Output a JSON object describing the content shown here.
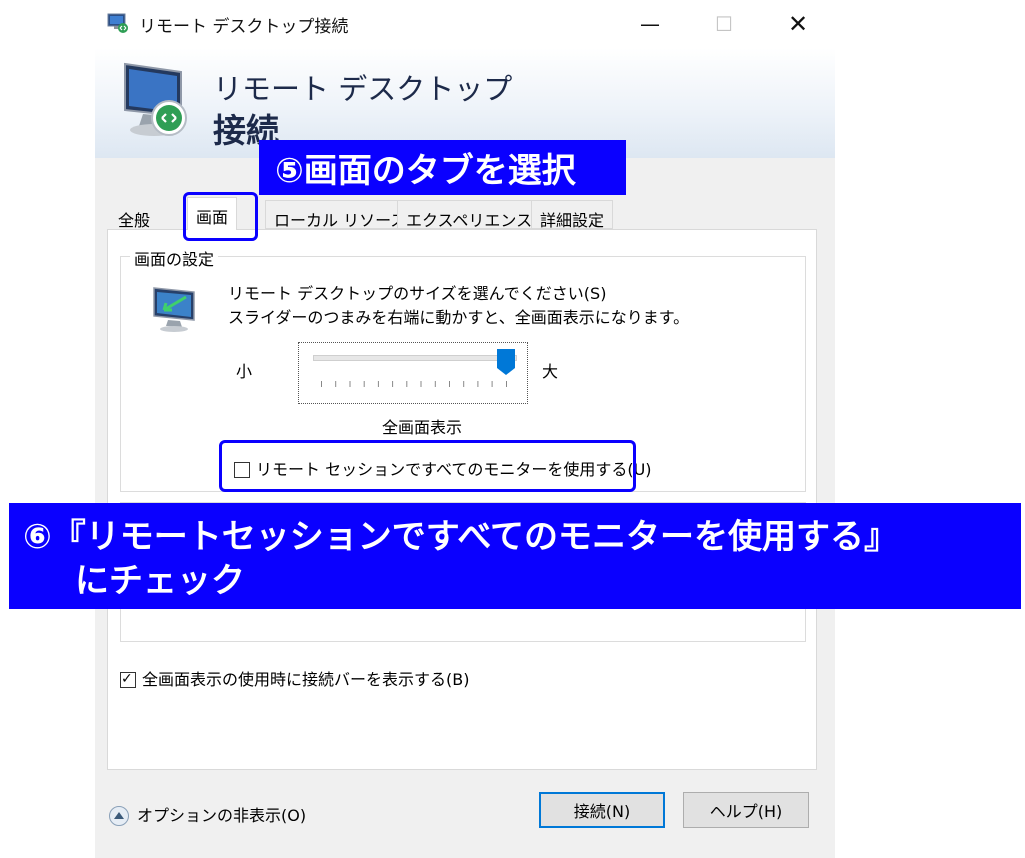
{
  "window": {
    "title": "リモート デスクトップ接続",
    "minimize_glyph": "—",
    "maximize_glyph": "☐",
    "close_glyph": "✕"
  },
  "banner": {
    "line1": "リモート デスクトップ",
    "line2": "接続"
  },
  "tabs": [
    {
      "label": "全般",
      "selected": false
    },
    {
      "label": "画面",
      "selected": true
    },
    {
      "label": "ローカル リソース",
      "selected": false
    },
    {
      "label": "エクスペリエンス",
      "selected": false
    },
    {
      "label": "詳細設定",
      "selected": false
    }
  ],
  "display": {
    "group_label": "画面の設定",
    "instruction_line1": "リモート デスクトップのサイズを選んでください(S)",
    "instruction_line2": "スライダーのつまみを右端に動かすと、全画面表示になります。",
    "slider_min_label": "小",
    "slider_max_label": "大",
    "slider_value_fraction": 1.0,
    "slider_value_label": "全画面表示",
    "all_monitors_label": "リモート セッションですべてのモニターを使用する(U)",
    "all_monitors_checked": false
  },
  "connection_bar": {
    "label": "全画面表示の使用時に接続バーを表示する(B)",
    "checked": true,
    "check_glyph": "✓"
  },
  "footer": {
    "options_label": "オプションの非表示(O)",
    "connect_label": "接続(N)",
    "help_label": "ヘルプ(H)"
  },
  "annotations": {
    "step5": "⑤画面のタブを選択",
    "step6_line1": "⑥『リモートセッションですべてのモニターを使用する』",
    "step6_line2": "にチェック"
  },
  "colors": {
    "annotation_blue": "#0a00ff",
    "accent": "#0078d7"
  }
}
